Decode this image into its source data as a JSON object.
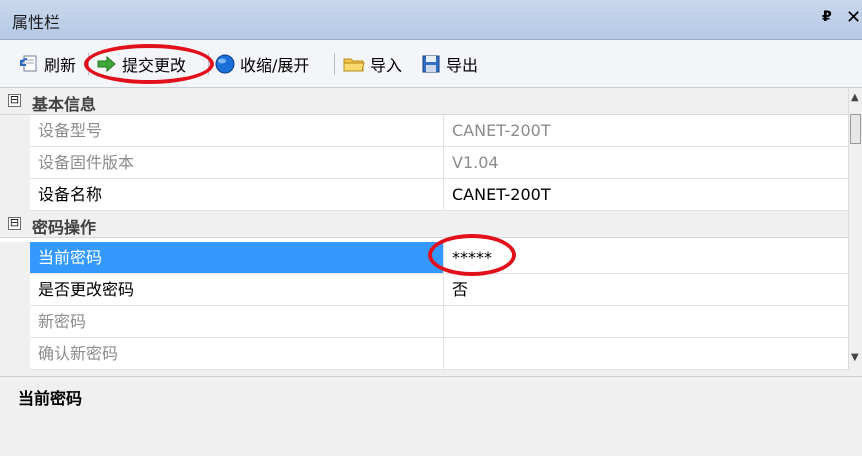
{
  "window": {
    "title": "属性栏",
    "pin_glyph": "₽",
    "close_glyph": "✕"
  },
  "toolbar": {
    "refresh_label": "刷新",
    "submit_label": "提交更改",
    "collapse_label": "收缩/展开",
    "import_label": "导入",
    "export_label": "导出"
  },
  "grid": {
    "categories": [
      {
        "label": "基本信息",
        "toggle": "⊟",
        "rows": [
          {
            "name": "设备型号",
            "value": "CANET-200T"
          },
          {
            "name": "设备固件版本",
            "value": "V1.04"
          },
          {
            "name": "设备名称",
            "value": "CANET-200T"
          }
        ]
      },
      {
        "label": "密码操作",
        "toggle": "⊟",
        "rows": [
          {
            "name": "当前密码",
            "value": "*****"
          },
          {
            "name": "是否更改密码",
            "value": "否"
          },
          {
            "name": "新密码",
            "value": ""
          },
          {
            "name": "确认新密码",
            "value": ""
          }
        ]
      }
    ]
  },
  "description": {
    "title": "当前密码"
  },
  "colors": {
    "selection": "#3399ff",
    "annotation": "#e2101a",
    "titlebar": "#c9d8ed"
  }
}
